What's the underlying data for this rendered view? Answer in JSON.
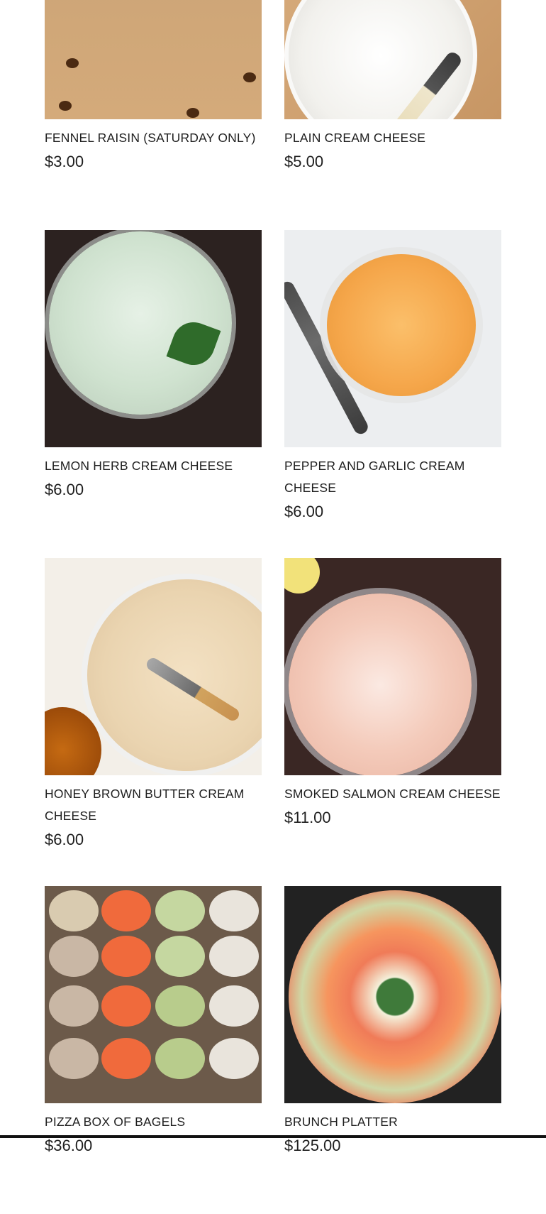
{
  "products": [
    {
      "name": "FENNEL RAISIN (SATURDAY ONLY)",
      "price": "$3.00",
      "image": "fennel-raisin-bread-photo"
    },
    {
      "name": "PLAIN CREAM CHEESE",
      "price": "$5.00",
      "image": "plain-cream-cheese-photo"
    },
    {
      "name": "LEMON HERB CREAM CHEESE",
      "price": "$6.00",
      "image": "lemon-herb-cream-cheese-photo"
    },
    {
      "name": "PEPPER AND GARLIC CREAM CHEESE",
      "price": "$6.00",
      "image": "pepper-garlic-cream-cheese-photo"
    },
    {
      "name": "HONEY BROWN BUTTER CREAM CHEESE",
      "price": "$6.00",
      "image": "honey-brown-butter-cream-cheese-photo"
    },
    {
      "name": "SMOKED SALMON CREAM CHEESE",
      "price": "$11.00",
      "image": "smoked-salmon-cream-cheese-photo"
    },
    {
      "name": "PIZZA BOX OF BAGELS",
      "price": "$36.00",
      "image": "pizza-box-of-bagels-photo"
    },
    {
      "name": "BRUNCH PLATTER",
      "price": "$125.00",
      "image": "brunch-platter-photo"
    }
  ]
}
